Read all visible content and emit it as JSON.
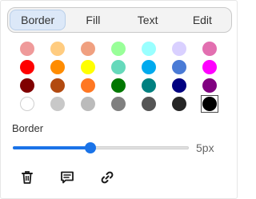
{
  "tabs": [
    {
      "label": "Border",
      "active": true
    },
    {
      "label": "Fill",
      "active": false
    },
    {
      "label": "Text",
      "active": false
    },
    {
      "label": "Edit",
      "active": false
    }
  ],
  "swatches": [
    [
      "#ef9a9a",
      "#ffcc80",
      "#f0a080",
      "#99ff99",
      "#99ffff",
      "#d9d0ff",
      "#e26fb0"
    ],
    [
      "#ff0000",
      "#ff8c00",
      "#ffff00",
      "#66d9bb",
      "#00aaee",
      "#4a7bd6",
      "#ff00ff"
    ],
    [
      "#800000",
      "#b24a10",
      "#ff7722",
      "#007700",
      "#008080",
      "#000080",
      "#800080"
    ],
    [
      "#ffffff",
      "#c8c8c8",
      "#bbbbbb",
      "#808080",
      "#555555",
      "#262626",
      "#000000"
    ]
  ],
  "selected_swatch": "#000000",
  "border_section": {
    "label": "Border",
    "value_label": "5px",
    "level_fraction": 0.44
  },
  "toolbar": {
    "icons": [
      "trash-icon",
      "comment-icon",
      "link-icon"
    ]
  },
  "accent_color": "#1a73e8"
}
